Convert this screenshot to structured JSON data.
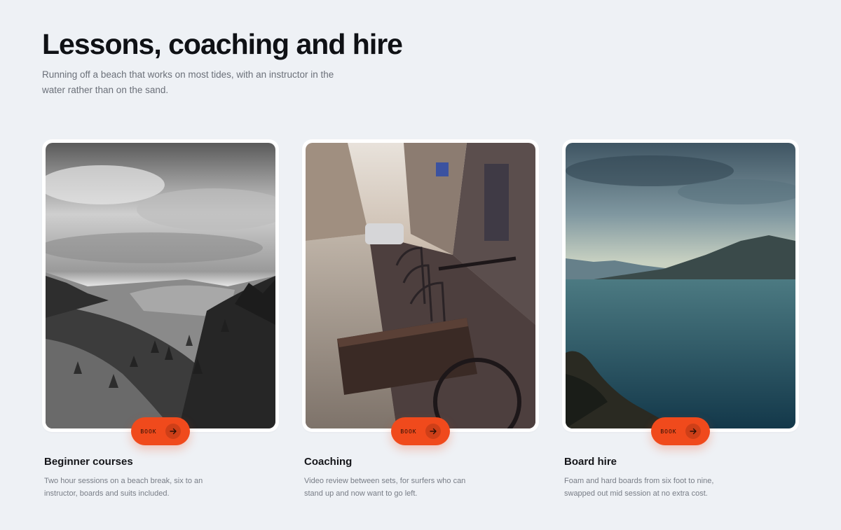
{
  "header": {
    "title": "Lessons, coaching and hire",
    "subtitle": "Running off a beach that works on most tides, with an instructor in the water rather than on the sand."
  },
  "cards": [
    {
      "title": "Beginner courses",
      "description": "Two hour sessions on a beach break, six to an instructor, boards and suits included.",
      "button_label": "BOOK",
      "image": "black-and-white forested hillside landscape",
      "icon": "arrow-right-icon"
    },
    {
      "title": "Coaching",
      "description": "Video review between sets, for surfers who can stand up and now want to go left.",
      "button_label": "BOOK",
      "image": "city street with bicycle and basket",
      "icon": "arrow-right-icon"
    },
    {
      "title": "Board hire",
      "description": "Foam and hard boards from six foot to nine, swapped out mid session at no extra cost.",
      "button_label": "BOOK",
      "image": "lake and mountains at dusk",
      "icon": "arrow-right-icon"
    }
  ],
  "colors": {
    "background": "#eef1f5",
    "accent": "#f04a1c",
    "title": "#0f1115",
    "muted_text": "#6b7079"
  }
}
